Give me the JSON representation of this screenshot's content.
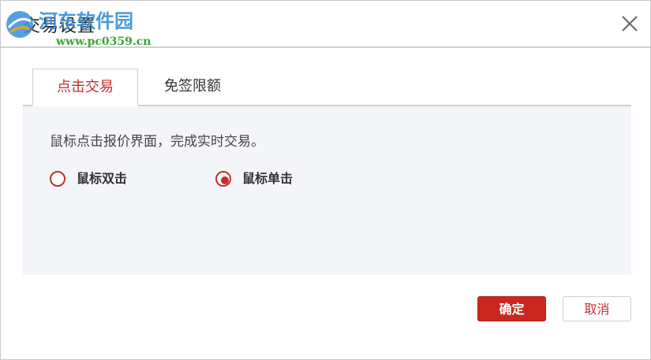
{
  "dialog": {
    "title": "交易设置",
    "close_icon": "close-icon"
  },
  "watermark": {
    "line1": "河东软件园",
    "line2": "www.pc0359.cn"
  },
  "tabs": [
    {
      "label": "点击交易",
      "active": true
    },
    {
      "label": "免签限额",
      "active": false
    }
  ],
  "panel": {
    "description": "鼠标点击报价界面，完成实时交易。",
    "options": [
      {
        "label": "鼠标双击",
        "selected": false
      },
      {
        "label": "鼠标单击",
        "selected": true
      }
    ]
  },
  "buttons": {
    "ok_label": "确定",
    "cancel_label": "取消"
  },
  "colors": {
    "accent": "#c0302b",
    "panel_bg": "#f4f5f9",
    "ok_bg": "#c8281f"
  }
}
